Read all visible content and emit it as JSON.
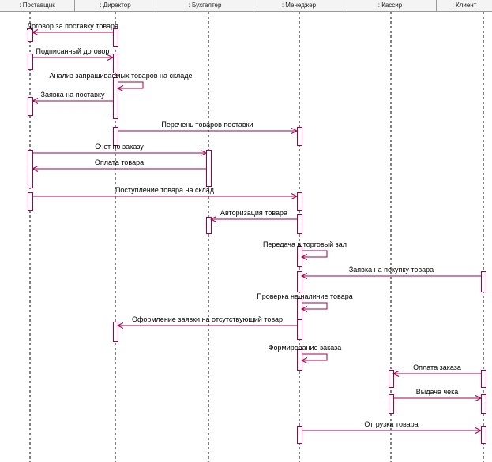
{
  "colors": {
    "message": "#a0004a",
    "lifeline": "#000000",
    "activation_fill": "#ffffff",
    "header_bg": "#f4f4f4",
    "header_border": "#9a9a9a"
  },
  "lifelines": [
    {
      "id": "supplier",
      "label": ": Поставщик"
    },
    {
      "id": "director",
      "label": ": Директор"
    },
    {
      "id": "accountant",
      "label": ": Бухгалтер"
    },
    {
      "id": "manager",
      "label": ": Менеджер"
    },
    {
      "id": "cashier",
      "label": ": Кассир"
    },
    {
      "id": "client",
      "label": ": Клиент"
    }
  ],
  "messages": [
    {
      "from": "director",
      "to": "supplier",
      "text": "Договор за поставку товара"
    },
    {
      "from": "supplier",
      "to": "director",
      "text": "Подписанный договор"
    },
    {
      "from": "director",
      "to": "director",
      "text": "Анализ запрашиваемых товаров на складе"
    },
    {
      "from": "director",
      "to": "supplier",
      "text": "Заявка на поставку"
    },
    {
      "from": "director",
      "to": "manager",
      "text": "Перечень товаров поставки"
    },
    {
      "from": "supplier",
      "to": "accountant",
      "text": "Счет по заказу"
    },
    {
      "from": "accountant",
      "to": "supplier",
      "text": "Оплата товара"
    },
    {
      "from": "supplier",
      "to": "manager",
      "text": "Поступление товара на склад"
    },
    {
      "from": "manager",
      "to": "accountant",
      "text": "Авторизация товара"
    },
    {
      "from": "manager",
      "to": "manager",
      "text": "Передача в торговый зал"
    },
    {
      "from": "client",
      "to": "manager",
      "text": "Заявка на покупку товара"
    },
    {
      "from": "manager",
      "to": "manager",
      "text": "Проверка на наличие товара"
    },
    {
      "from": "manager",
      "to": "director",
      "text": "Оформление заявки на отсутствующий товар"
    },
    {
      "from": "manager",
      "to": "manager",
      "text": "Формирование заказа"
    },
    {
      "from": "client",
      "to": "cashier",
      "text": "Оплата заказа"
    },
    {
      "from": "cashier",
      "to": "client",
      "text": "Выдача чека"
    },
    {
      "from": "manager",
      "to": "client",
      "text": "Отгрузка товара"
    }
  ]
}
